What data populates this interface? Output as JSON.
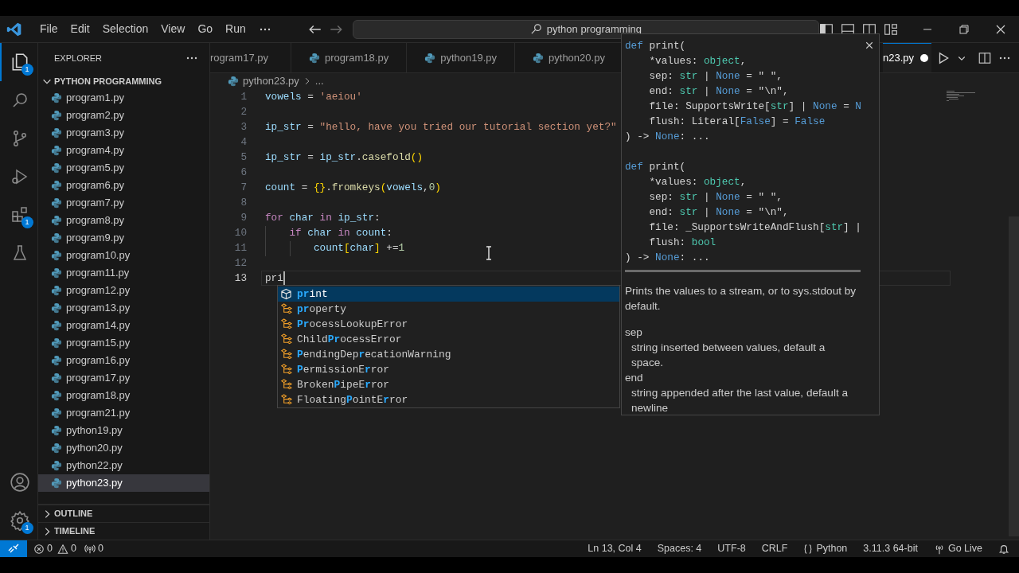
{
  "title_bar": {
    "menus": [
      "File",
      "Edit",
      "Selection",
      "View",
      "Go",
      "Run"
    ],
    "search": "python programming"
  },
  "activity_bar": {
    "items": [
      {
        "kind": "explorer",
        "selected": true,
        "badge": "1"
      },
      {
        "kind": "search",
        "selected": false
      },
      {
        "kind": "source_control",
        "selected": false
      },
      {
        "kind": "run_debug",
        "selected": false
      },
      {
        "kind": "extensions",
        "selected": false,
        "badge": "1"
      },
      {
        "kind": "testing",
        "selected": false
      }
    ],
    "bottom": [
      {
        "kind": "account"
      },
      {
        "kind": "settings",
        "badge": "1"
      }
    ]
  },
  "sidebar": {
    "title": "EXPLORER",
    "folder": {
      "name": "PYTHON PROGRAMMING",
      "expanded": true,
      "files": [
        {
          "name": "program1.py",
          "selected": false
        },
        {
          "name": "program2.py",
          "selected": false
        },
        {
          "name": "program3.py",
          "selected": false
        },
        {
          "name": "program4.py",
          "selected": false
        },
        {
          "name": "program5.py",
          "selected": false
        },
        {
          "name": "program6.py",
          "selected": false
        },
        {
          "name": "program7.py",
          "selected": false
        },
        {
          "name": "program8.py",
          "selected": false
        },
        {
          "name": "program9.py",
          "selected": false
        },
        {
          "name": "program10.py",
          "selected": false
        },
        {
          "name": "program11.py",
          "selected": false
        },
        {
          "name": "program12.py",
          "selected": false
        },
        {
          "name": "program13.py",
          "selected": false
        },
        {
          "name": "program14.py",
          "selected": false
        },
        {
          "name": "program15.py",
          "selected": false
        },
        {
          "name": "program16.py",
          "selected": false
        },
        {
          "name": "program17.py",
          "selected": false
        },
        {
          "name": "program18.py",
          "selected": false
        },
        {
          "name": "program21.py",
          "selected": false
        },
        {
          "name": "python19.py",
          "selected": false
        },
        {
          "name": "python20.py",
          "selected": false
        },
        {
          "name": "python22.py",
          "selected": false
        },
        {
          "name": "python23.py",
          "selected": true
        }
      ]
    },
    "sections": [
      {
        "name": "OUTLINE",
        "expanded": false
      },
      {
        "name": "TIMELINE",
        "expanded": false
      }
    ]
  },
  "editor": {
    "tabs": [
      {
        "label": "rogram17.py",
        "selected": false,
        "file_icon": false
      },
      {
        "label": "program18.py",
        "selected": false,
        "file_icon": true
      },
      {
        "label": "python19.py",
        "selected": false,
        "file_icon": true
      },
      {
        "label": "python20.py",
        "selected": false,
        "file_icon": true
      }
    ],
    "active_tab": {
      "label": "n23.py",
      "selected": true,
      "modified": true
    },
    "breadcrumb": {
      "file": "python23.py",
      "more": "..."
    },
    "lines": [
      {
        "number": "1",
        "current": false,
        "tokens": [
          {
            "text": "vowels",
            "kind": "var"
          },
          {
            "text": " = ",
            "kind": "op"
          },
          {
            "text": "'aeiou'",
            "kind": "string"
          }
        ]
      },
      {
        "number": "2",
        "current": false
      },
      {
        "number": "3",
        "current": false,
        "tokens": [
          {
            "text": "ip_str",
            "kind": "var"
          },
          {
            "text": " = ",
            "kind": "op"
          },
          {
            "text": "\"hello, have you tried our tutorial section yet?\"",
            "kind": "string"
          }
        ]
      },
      {
        "number": "4",
        "current": false
      },
      {
        "number": "5",
        "current": false,
        "tokens": [
          {
            "text": "ip_str",
            "kind": "var"
          },
          {
            "text": " = ",
            "kind": "op"
          },
          {
            "text": "ip_str",
            "kind": "var"
          },
          {
            "text": ".",
            "kind": "op"
          },
          {
            "text": "casefold",
            "kind": "func"
          },
          {
            "text": "()",
            "kind": "bracket"
          }
        ]
      },
      {
        "number": "6",
        "current": false
      },
      {
        "number": "7",
        "current": false,
        "tokens": [
          {
            "text": "count",
            "kind": "var"
          },
          {
            "text": " = ",
            "kind": "op"
          },
          {
            "text": "{}",
            "kind": "bracket"
          },
          {
            "text": ".",
            "kind": "op"
          },
          {
            "text": "fromkeys",
            "kind": "func"
          },
          {
            "text": "(",
            "kind": "bracket"
          },
          {
            "text": "vowels",
            "kind": "var"
          },
          {
            "text": ",",
            "kind": "op"
          },
          {
            "text": "0",
            "kind": "number"
          },
          {
            "text": ")",
            "kind": "bracket"
          }
        ]
      },
      {
        "number": "8",
        "current": false
      },
      {
        "number": "9",
        "current": false,
        "tokens": [
          {
            "text": "for ",
            "kind": "control"
          },
          {
            "text": "char",
            "kind": "var"
          },
          {
            "text": " in ",
            "kind": "control"
          },
          {
            "text": "ip_str",
            "kind": "var"
          },
          {
            "text": ":",
            "kind": "op"
          }
        ]
      },
      {
        "number": "10",
        "current": false,
        "tokens": [
          {
            "text": "    if ",
            "kind": "control"
          },
          {
            "text": "char",
            "kind": "var"
          },
          {
            "text": " in ",
            "kind": "control"
          },
          {
            "text": "count",
            "kind": "var"
          },
          {
            "text": ":",
            "kind": "op"
          }
        ]
      },
      {
        "number": "11",
        "current": false,
        "tokens": [
          {
            "text": "        count",
            "kind": "var"
          },
          {
            "text": "[",
            "kind": "bracket"
          },
          {
            "text": "char",
            "kind": "var"
          },
          {
            "text": "]",
            "kind": "bracket"
          },
          {
            "text": " +=",
            "kind": "op"
          },
          {
            "text": "1",
            "kind": "number"
          }
        ]
      },
      {
        "number": "12",
        "current": false
      },
      {
        "number": "13",
        "current": true,
        "tokens": [
          {
            "text": "pri",
            "kind": "plain"
          }
        ]
      }
    ]
  },
  "suggestions": [
    {
      "kind": "function",
      "selected": true,
      "parts": [
        {
          "text": "pr",
          "match": true
        },
        {
          "text": "int",
          "match": false
        }
      ]
    },
    {
      "kind": "class",
      "selected": false,
      "parts": [
        {
          "text": "pr",
          "match": true
        },
        {
          "text": "operty",
          "match": false
        }
      ]
    },
    {
      "kind": "class",
      "selected": false,
      "parts": [
        {
          "text": "Pr",
          "match": true
        },
        {
          "text": "ocessLookupError",
          "match": false
        }
      ]
    },
    {
      "kind": "class",
      "selected": false,
      "parts": [
        {
          "text": "Child",
          "match": false
        },
        {
          "text": "Pr",
          "match": true
        },
        {
          "text": "ocessError",
          "match": false
        }
      ]
    },
    {
      "kind": "class",
      "selected": false,
      "parts": [
        {
          "text": "P",
          "match": true
        },
        {
          "text": "endingDep",
          "match": false
        },
        {
          "text": "r",
          "match": true
        },
        {
          "text": "ecationWarning",
          "match": false
        }
      ]
    },
    {
      "kind": "class",
      "selected": false,
      "parts": [
        {
          "text": "P",
          "match": true
        },
        {
          "text": "ermissionE",
          "match": false
        },
        {
          "text": "r",
          "match": true
        },
        {
          "text": "ror",
          "match": false
        }
      ]
    },
    {
      "kind": "class",
      "selected": false,
      "parts": [
        {
          "text": "Broken",
          "match": false
        },
        {
          "text": "P",
          "match": true
        },
        {
          "text": "ipeE",
          "match": false
        },
        {
          "text": "r",
          "match": true
        },
        {
          "text": "ror",
          "match": false
        }
      ]
    },
    {
      "kind": "class",
      "selected": false,
      "parts": [
        {
          "text": "Floating",
          "match": false
        },
        {
          "text": "P",
          "match": true
        },
        {
          "text": "ointE",
          "match": false
        },
        {
          "text": "r",
          "match": true
        },
        {
          "text": "ror",
          "match": false
        }
      ]
    }
  ],
  "hover": {
    "signatures": [
      {
        "lines": [
          [
            {
              "text": "def",
              "kind": "def"
            },
            {
              "text": " print(",
              "kind": "plain"
            }
          ],
          [
            {
              "text": "    *values: ",
              "kind": "plain"
            },
            {
              "text": "object",
              "kind": "type"
            },
            {
              "text": ",",
              "kind": "plain"
            }
          ],
          [
            {
              "text": "    sep: ",
              "kind": "plain"
            },
            {
              "text": "str",
              "kind": "type"
            },
            {
              "text": " | ",
              "kind": "plain"
            },
            {
              "text": "None",
              "kind": "def"
            },
            {
              "text": " = \" \",",
              "kind": "plain"
            }
          ],
          [
            {
              "text": "    end: ",
              "kind": "plain"
            },
            {
              "text": "str",
              "kind": "type"
            },
            {
              "text": " | ",
              "kind": "plain"
            },
            {
              "text": "None",
              "kind": "def"
            },
            {
              "text": " = \"\\n\",",
              "kind": "plain"
            }
          ],
          [
            {
              "text": "    file: SupportsWrite[",
              "kind": "plain"
            },
            {
              "text": "str",
              "kind": "type"
            },
            {
              "text": "] | ",
              "kind": "plain"
            },
            {
              "text": "None",
              "kind": "def"
            },
            {
              "text": " = ",
              "kind": "plain"
            },
            {
              "text": "N",
              "kind": "def"
            }
          ],
          [
            {
              "text": "    flush: Literal[",
              "kind": "plain"
            },
            {
              "text": "False",
              "kind": "def"
            },
            {
              "text": "] = ",
              "kind": "plain"
            },
            {
              "text": "False",
              "kind": "def"
            }
          ],
          [
            {
              "text": ") -> ",
              "kind": "plain"
            },
            {
              "text": "None",
              "kind": "def"
            },
            {
              "text": ": ...",
              "kind": "plain"
            }
          ]
        ]
      },
      {
        "lines": [
          [
            {
              "text": "def",
              "kind": "def"
            },
            {
              "text": " print(",
              "kind": "plain"
            }
          ],
          [
            {
              "text": "    *values: ",
              "kind": "plain"
            },
            {
              "text": "object",
              "kind": "type"
            },
            {
              "text": ",",
              "kind": "plain"
            }
          ],
          [
            {
              "text": "    sep: ",
              "kind": "plain"
            },
            {
              "text": "str",
              "kind": "type"
            },
            {
              "text": " | ",
              "kind": "plain"
            },
            {
              "text": "None",
              "kind": "def"
            },
            {
              "text": " = \" \",",
              "kind": "plain"
            }
          ],
          [
            {
              "text": "    end: ",
              "kind": "plain"
            },
            {
              "text": "str",
              "kind": "type"
            },
            {
              "text": " | ",
              "kind": "plain"
            },
            {
              "text": "None",
              "kind": "def"
            },
            {
              "text": " = \"\\n\",",
              "kind": "plain"
            }
          ],
          [
            {
              "text": "    file: _SupportsWriteAndFlush[",
              "kind": "plain"
            },
            {
              "text": "str",
              "kind": "type"
            },
            {
              "text": "] |",
              "kind": "plain"
            }
          ],
          [
            {
              "text": "    flush: ",
              "kind": "plain"
            },
            {
              "text": "bool",
              "kind": "type"
            }
          ],
          [
            {
              "text": ") -> ",
              "kind": "plain"
            },
            {
              "text": "None",
              "kind": "def"
            },
            {
              "text": ": ...",
              "kind": "plain"
            }
          ]
        ]
      }
    ],
    "description": "Prints the values to a stream, or to sys.stdout by default.",
    "params": [
      {
        "name": "sep",
        "text": "string inserted between values, default a space."
      },
      {
        "name": "end",
        "text": "string appended after the last value, default a newline"
      }
    ]
  },
  "status_bar": {
    "errors": "0",
    "warnings": "0",
    "ports": "0",
    "right": [
      {
        "kind": "text",
        "text": "Ln 13, Col 4"
      },
      {
        "kind": "text",
        "text": "Spaces: 4"
      },
      {
        "kind": "text",
        "text": "UTF-8"
      },
      {
        "kind": "text",
        "text": "CRLF"
      },
      {
        "kind": "language",
        "text": "Python"
      },
      {
        "kind": "text",
        "text": "3.11.3 64-bit"
      },
      {
        "kind": "live",
        "text": "Go Live"
      },
      {
        "kind": "bell"
      }
    ]
  }
}
